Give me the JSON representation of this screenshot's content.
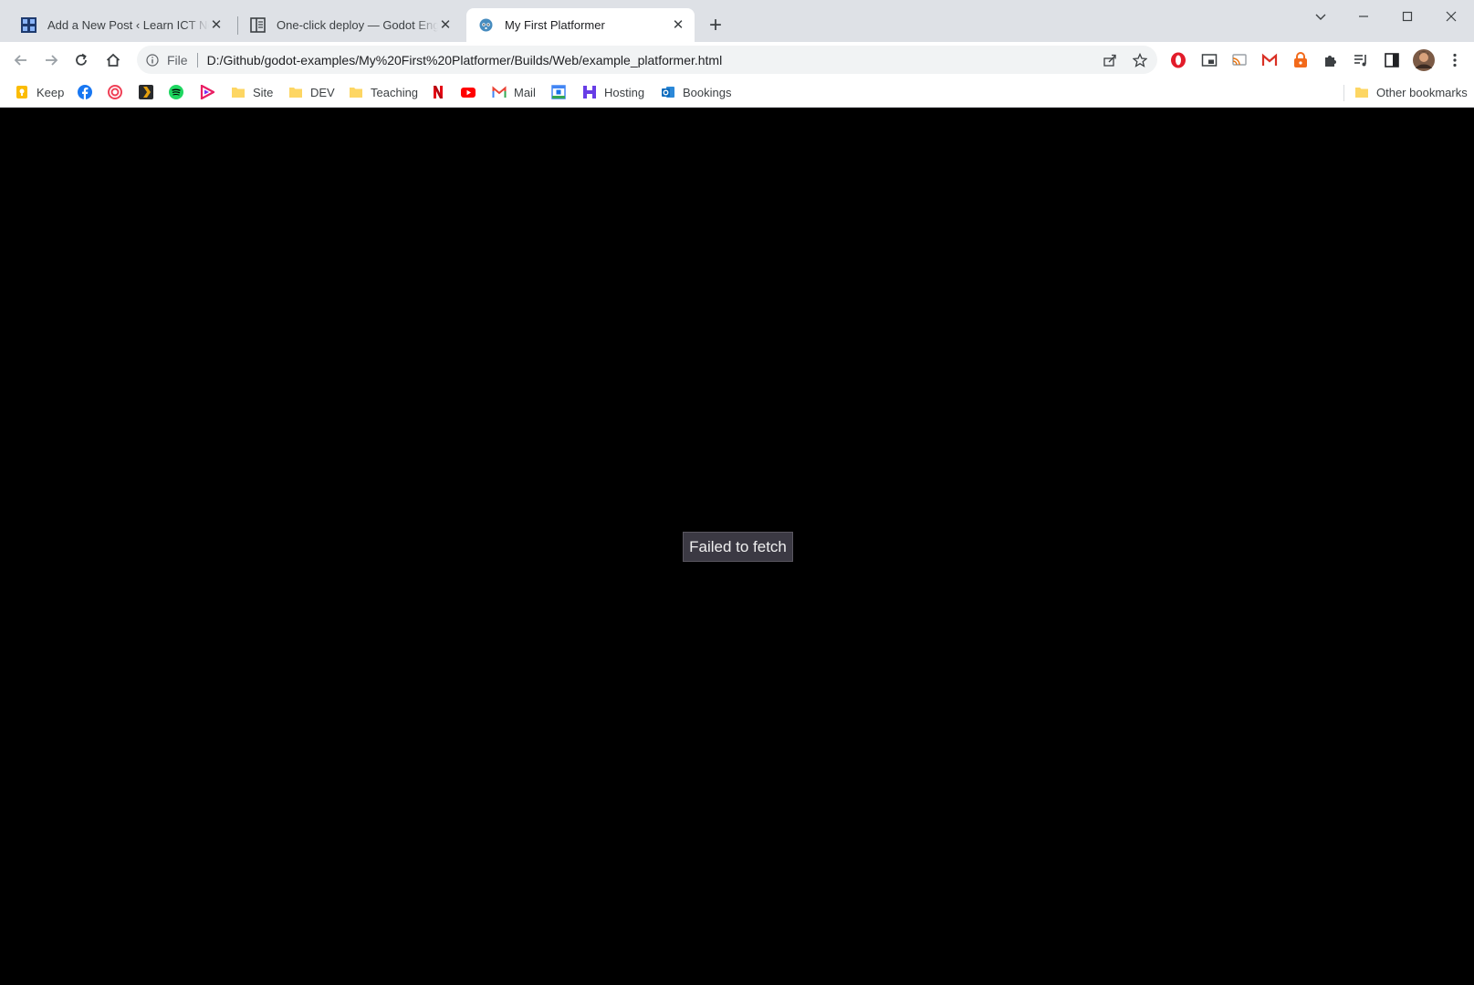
{
  "browser": {
    "tabs": [
      {
        "title": "Add a New Post ‹ Learn ICT Now — WordPress",
        "favicon": "wordpress-site-icon",
        "active": false
      },
      {
        "title": "One-click deploy — Godot Engine (stable) documentation",
        "favicon": "docs-page-icon",
        "active": false
      },
      {
        "title": "My First Platformer",
        "favicon": "godot-icon",
        "active": true
      }
    ],
    "close_glyph": "✕",
    "new_tab_glyph": "+"
  },
  "omnibox": {
    "scheme_label": "File",
    "url": "D:/Github/godot-examples/My%20First%20Platformer/Builds/Web/example_platformer.html"
  },
  "bookmarks": {
    "items": [
      {
        "label": "Keep",
        "icon": "keep-icon"
      },
      {
        "label": "",
        "icon": "facebook-icon"
      },
      {
        "label": "",
        "icon": "pocket-icon"
      },
      {
        "label": "",
        "icon": "plex-icon"
      },
      {
        "label": "",
        "icon": "spotify-icon"
      },
      {
        "label": "",
        "icon": "play-icon"
      },
      {
        "label": "Site",
        "icon": "folder-icon"
      },
      {
        "label": "DEV",
        "icon": "folder-icon"
      },
      {
        "label": "Teaching",
        "icon": "folder-icon"
      },
      {
        "label": "",
        "icon": "netflix-icon"
      },
      {
        "label": "",
        "icon": "youtube-icon"
      },
      {
        "label": "Mail",
        "icon": "gmail-icon"
      },
      {
        "label": "",
        "icon": "calendar-icon"
      },
      {
        "label": "Hosting",
        "icon": "hosting-icon"
      },
      {
        "label": "Bookings",
        "icon": "bookings-icon"
      }
    ],
    "other_label": "Other bookmarks"
  },
  "page": {
    "status_text": "Failed to fetch"
  },
  "colors": {
    "tabstrip": "#dee1e6",
    "toolbar": "#ffffff",
    "content_background": "#000000",
    "status_background": "#3b3943",
    "status_text": "#f0f0f0"
  }
}
